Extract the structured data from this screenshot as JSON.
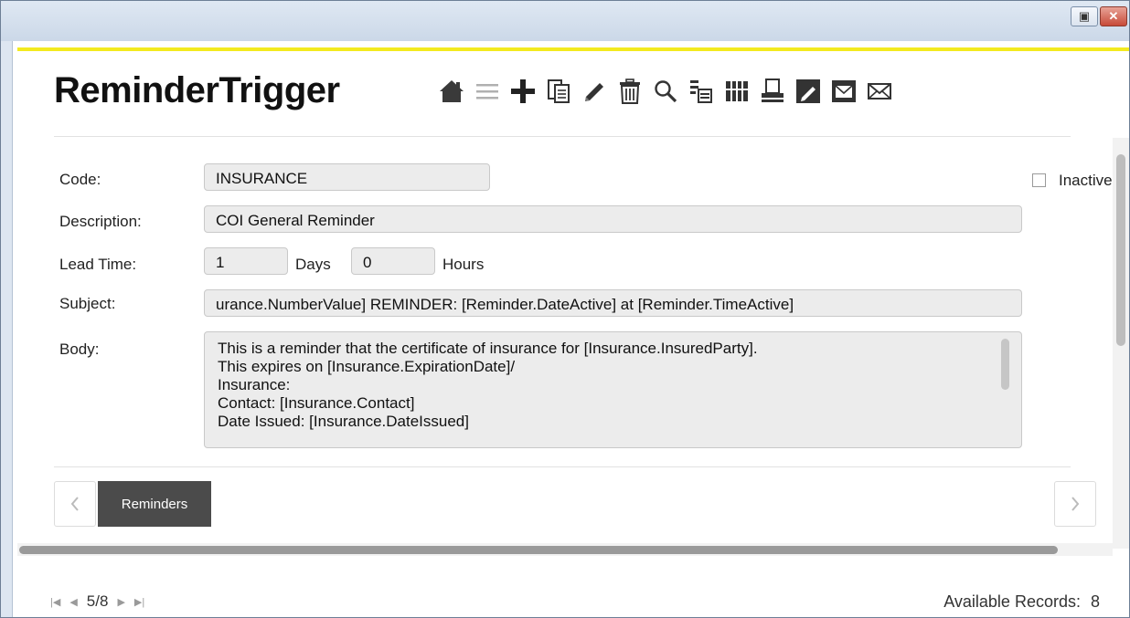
{
  "window": {
    "restore_glyph": "▣",
    "close_glyph": "✕"
  },
  "header": {
    "title": "ReminderTrigger",
    "toolbar": [
      "home-icon",
      "list-icon",
      "add-icon",
      "copy-icon",
      "edit-pencil-icon",
      "delete-icon",
      "search-icon",
      "tree-icon",
      "columns-icon",
      "print-icon",
      "note-edit-icon",
      "email-icon",
      "mail-icon"
    ]
  },
  "form": {
    "code_label": "Code:",
    "code_value": "INSURANCE",
    "inactive_label": "Inactive",
    "description_label": "Description:",
    "description_value": "COI General Reminder",
    "lead_time_label": "Lead Time:",
    "lead_days_value": "1",
    "days_label": "Days",
    "lead_hours_value": "0",
    "hours_label": "Hours",
    "subject_label": "Subject:",
    "subject_value": "urance.NumberValue] REMINDER: [Reminder.DateActive] at [Reminder.TimeActive]",
    "body_label": "Body:",
    "body_value": "This is a reminder that the certificate of insurance for [Insurance.InsuredParty].\nThis expires on [Insurance.ExpirationDate]/\nInsurance:\nContact: [Insurance.Contact]\nDate Issued: [Insurance.DateIssued]"
  },
  "tabs": {
    "items": [
      {
        "label": "Reminders",
        "active": true
      }
    ]
  },
  "footer": {
    "page_position": "5/8",
    "records_label": "Available Records:",
    "records_count": "8"
  }
}
